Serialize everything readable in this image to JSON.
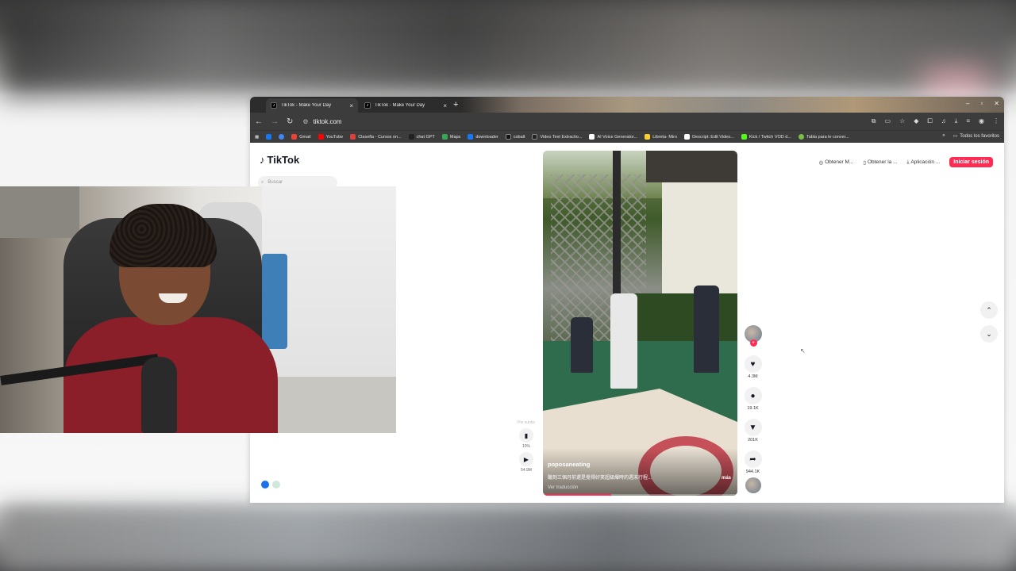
{
  "browser": {
    "tabs": [
      {
        "title": "TikTok - Make Your Day",
        "active": true
      },
      {
        "title": "TikTok - Make Your Day",
        "active": false
      }
    ],
    "new_tab": "+",
    "window_controls": [
      "–",
      "▫",
      "✕"
    ],
    "url": "tiktok.com",
    "bookmarks": [
      {
        "label": "Gmail",
        "color": "#ea4335"
      },
      {
        "label": "YouTube",
        "color": "#ff0000"
      },
      {
        "label": "Clasefla - Cursos on...",
        "color": "#d9413b"
      },
      {
        "label": "chat GPT",
        "color": "#222222"
      },
      {
        "label": "Maps",
        "color": "#34a853"
      },
      {
        "label": "downloader",
        "color": "#1877f2"
      },
      {
        "label": "cobalt",
        "color": "#111111"
      },
      {
        "label": "Video Text Extractio...",
        "color": "#222222"
      },
      {
        "label": "AI Voice Generator...",
        "color": "#ffffff"
      },
      {
        "label": "Libreta- Miro",
        "color": "#ffd02f"
      },
      {
        "label": "Descript: Edit Video...",
        "color": "#ffffff"
      },
      {
        "label": "Kick / Twitch VOD d...",
        "color": "#53fc18"
      },
      {
        "label": "Tabla para le conver...",
        "color": "#7ac143"
      }
    ],
    "bookmarks_more": "»",
    "all_bookmarks": "Todos los favoritos"
  },
  "tiktok": {
    "logo": "TikTok",
    "search_placeholder": "Buscar",
    "top_actions": [
      {
        "label": "Obtener M...",
        "icon": "coin-icon"
      },
      {
        "label": "Obtener la ...",
        "icon": "phone-icon"
      },
      {
        "label": "Aplicación ...",
        "icon": "download-icon"
      }
    ],
    "login_button": "Iniciar sesión",
    "video": {
      "author": "poposaneating",
      "description": "聽到三個月前還是覺得好笑超級爆時的週末行程...",
      "more": "más",
      "translate": "Ver traducción",
      "progress": 0.35
    },
    "player_controls": {
      "label": "Pie sunks",
      "speed_value": "10%",
      "views": "54.9M"
    },
    "actions": {
      "likes": "4.3M",
      "comments": "19.1K",
      "saves": "201K",
      "shares": "944.1K"
    }
  },
  "colors": {
    "accent": "#fe2c55",
    "browser_chrome": "#3c3c3c"
  }
}
